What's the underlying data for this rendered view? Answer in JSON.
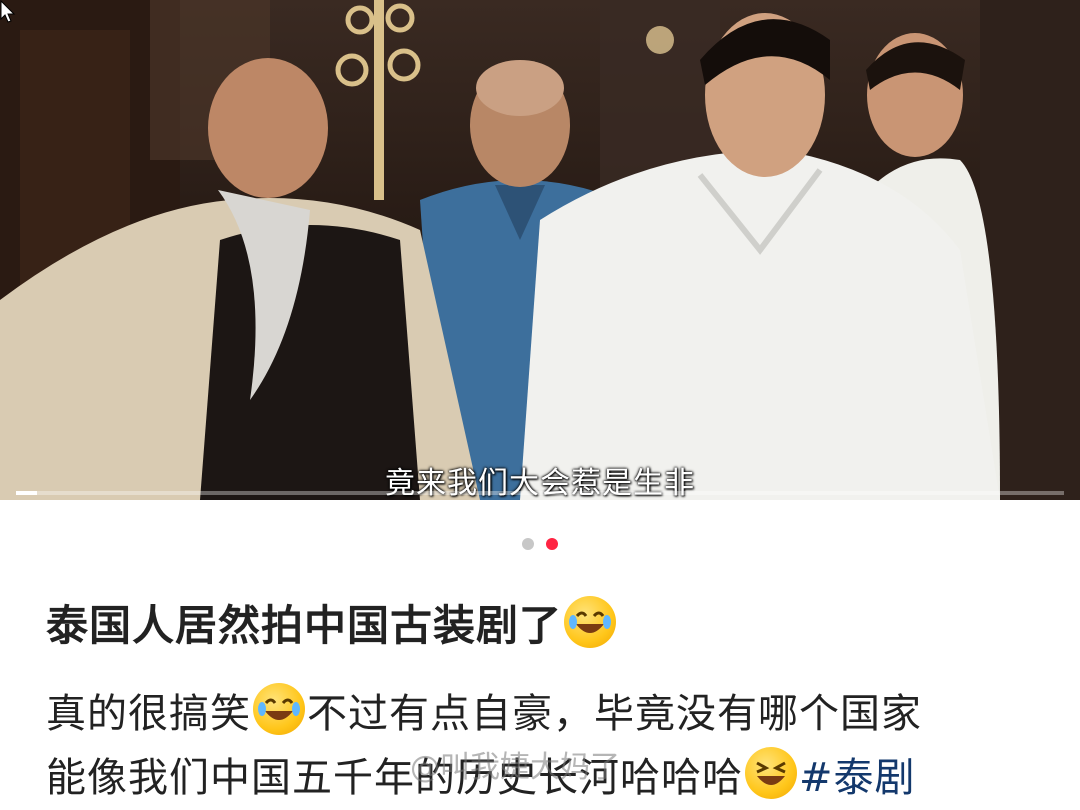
{
  "video": {
    "subtitle": "竟来我们大会惹是生非",
    "progress": 0.02
  },
  "carousel": {
    "active_index": 1,
    "count": 2,
    "active_color": "#ff2442",
    "inactive_color": "#c7c7c7"
  },
  "post": {
    "title": "泰国人居然拍中国古装剧了",
    "body_line1_a": "真的很搞笑",
    "body_line1_b": "不过有点自豪，毕竟没有哪个国家",
    "body_line2_a": "能像我们中国五千年的历史长河哈哈哈",
    "hashtag": "#泰剧",
    "emojis": [
      "laughing-tears-emoji",
      "laughing-tears-emoji",
      "grinning-squint-emoji"
    ]
  },
  "watermark": "@叫我婕大妈了"
}
